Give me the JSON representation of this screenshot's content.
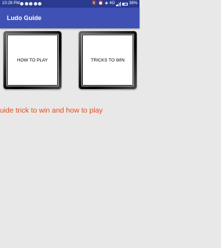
{
  "status_bar": {
    "time": "10:28 PM",
    "network": "4G",
    "battery": "36%",
    "notification_icons": [
      "notification-icon",
      "notification-icon",
      "notification-icon",
      "notification-icon",
      "notification-icon"
    ],
    "color": "#293a8f"
  },
  "app_bar": {
    "title": "Ludo Guide",
    "color": "#3f51b5"
  },
  "buttons": {
    "how_to_play": "HOW TO PLAY",
    "tricks_to_win": "TRICKS TO WIN"
  },
  "tagline": {
    "text": "guide trick to win and how to play",
    "color": "#e64a19"
  }
}
